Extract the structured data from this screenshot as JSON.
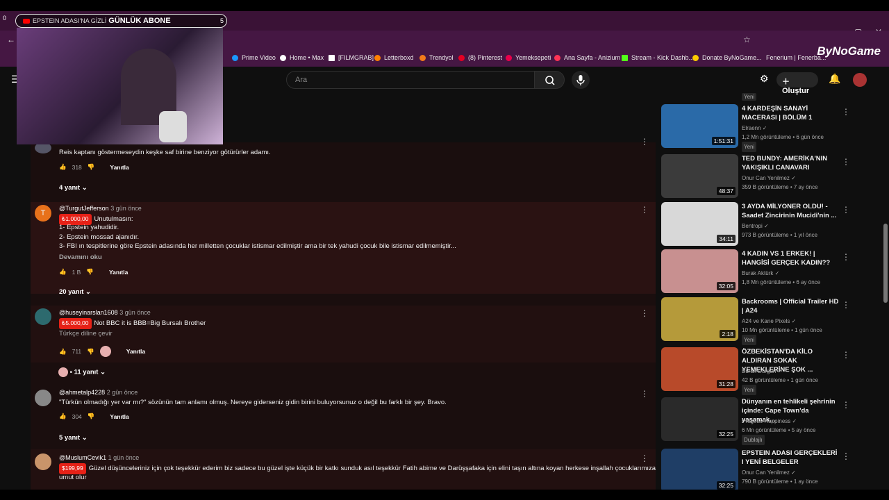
{
  "browser": {
    "tab_count": "0",
    "tab_title": "EPSTEIN ADASI'NA GİZLİ",
    "overlay_title": "GÜNLÜK ABONE",
    "overlay_count": "5",
    "bookmarks": [
      {
        "label": "Prime Video",
        "color": "#1a98ff"
      },
      {
        "label": "Home • Max",
        "color": "#ffffff"
      },
      {
        "label": "[FILMGRAB]",
        "color": "#ffffff"
      },
      {
        "label": "Letterboxd",
        "color": "#ff8000"
      },
      {
        "label": "Trendyol",
        "color": "#f27a1a"
      },
      {
        "label": "(8) Pinterest",
        "color": "#e60023"
      },
      {
        "label": "Yemeksepeti",
        "color": "#ea004b"
      },
      {
        "label": "Ana Sayfa - Anizium",
        "color": "#ff3355"
      },
      {
        "label": "Stream - Kick Dashb...",
        "color": "#53fc18"
      },
      {
        "label": "Donate ByNoGame...",
        "color": "#ffcc00"
      },
      {
        "label": "Fenerium | Fenerba...",
        "color": "#ffee00"
      }
    ],
    "brand": "ByNoGame"
  },
  "youtube": {
    "search_placeholder": "Ara",
    "create_label": "Oluştur"
  },
  "comments": [
    {
      "text": "Reis kaptanı göstermeseydin keşke saf birine benziyor götürürler adamı.",
      "likes": "318",
      "reply_label": "Yanıtla",
      "replies": "4 yanıt"
    },
    {
      "author": "@TurgutJefferson",
      "time": "3 gün önce",
      "donation": "₺1.000,00",
      "lines": [
        "Unutulmasın:",
        "1- Epstein yahudidir.",
        "2- Epstein mossad ajanıdır.",
        "3- FBI ın tespitlerine göre Epstein adasında her milletten çocuklar istismar edilmiştir ama bir tek yahudi çocuk bile istismar edilmemiştir..."
      ],
      "read_more": "Devamını oku",
      "likes": "1 B",
      "reply_label": "Yanıtla",
      "replies": "20 yanıt",
      "avatar_letter": "T"
    },
    {
      "author": "@huseyinarslan1608",
      "time": "3 gün önce",
      "donation": "₺5.000,00",
      "text": "Not BBC it is BBB=Big Bursalı Brother",
      "translate": "Türkçe diline çevir",
      "likes": "711",
      "reply_label": "Yanıtla",
      "replies": "• 11 yanıt"
    },
    {
      "author": "@ahmetalp4228",
      "time": "2 gün önce",
      "text": "\"Türkün olmadığı yer var mı?\" sözünün tam anlamı olmuş. Nereye giderseniz gidin birini buluyorsunuz o değil bu farklı bir şey. Bravo.",
      "likes": "304",
      "reply_label": "Yanıtla",
      "replies": "5 yanıt"
    },
    {
      "author": "@MuslumCevik1",
      "time": "1 gün önce",
      "donation": "$199,99",
      "text": "Güzel düşünceleriniz için çok teşekkür ederim biz sadece bu güzel işte küçük bir katkı sunduk asıl teşekkür Fatih abime ve Darüşşafaka için elini taşın altına koyan herkese inşallah çocuklarımıza",
      "text2": "umut olur"
    }
  ],
  "sidebar": {
    "top_badge": "Yeni",
    "videos": [
      {
        "title": "4 KARDEŞİN SANAYİ MACERASI | BÖLÜM 1",
        "channel": "Elraenn",
        "meta": "1,2 Mn görüntüleme • 6 gün önce",
        "badge": "Yeni",
        "duration": "1:51:31",
        "color": "#2a6aa8"
      },
      {
        "title": "TED BUNDY: AMERİKA'NIN YAKIŞIKLI CANAVARI",
        "channel": "Onur Can Yenilmez",
        "meta": "359 B görüntüleme • 7 ay önce",
        "badge": "",
        "duration": "48:37",
        "color": "#3b3b3b"
      },
      {
        "title": "3 AYDA MİLYONER OLDU! - Saadet Zincirinin Mucidi'nin ...",
        "channel": "Bentropi",
        "meta": "973 B görüntüleme • 1 yıl önce",
        "badge": "",
        "duration": "34:11",
        "color": "#d8d8d8"
      },
      {
        "title": "4 KADIN VS 1 ERKEK! | HANGİSİ GERÇEK KADIN??",
        "channel": "Burak Aktürk",
        "meta": "1,8 Mn görüntüleme • 6 ay önce",
        "badge": "",
        "duration": "32:05",
        "color": "#c89090"
      },
      {
        "title": "Backrooms | Official Trailer HD | A24",
        "channel": "A24 ve Kane Pixels",
        "meta": "10 Mn görüntüleme • 1 gün önce",
        "badge": "Yeni",
        "duration": "2:18",
        "color": "#b59a3a"
      },
      {
        "title": "ÖZBEKİSTAN'DA KİLO ALDIRAN SOKAK YEMEKLERİNE ŞOK ...",
        "channel": "Burak Durgun",
        "meta": "42 B görüntüleme • 1 gün önce",
        "badge": "Yeni",
        "duration": "31:28",
        "color": "#b84a2a"
      },
      {
        "title": "Dünyanın en tehlikeli şehrinin içinde: Cape Town'da yaşamak...",
        "channel": "Progetto Happiness",
        "meta": "6 Mn görüntüleme • 5 ay önce",
        "badge": "Dublajlı",
        "duration": "32:25",
        "color": "#2a2a2a"
      },
      {
        "title": "EPSTEIN ADASI GERÇEKLERİ I YENİ BELGELER",
        "channel": "Onur Can Yenilmez",
        "meta": "790 B görüntüleme • 1 ay önce",
        "badge": "",
        "duration": "32:25",
        "color": "#1f3e66"
      }
    ]
  }
}
